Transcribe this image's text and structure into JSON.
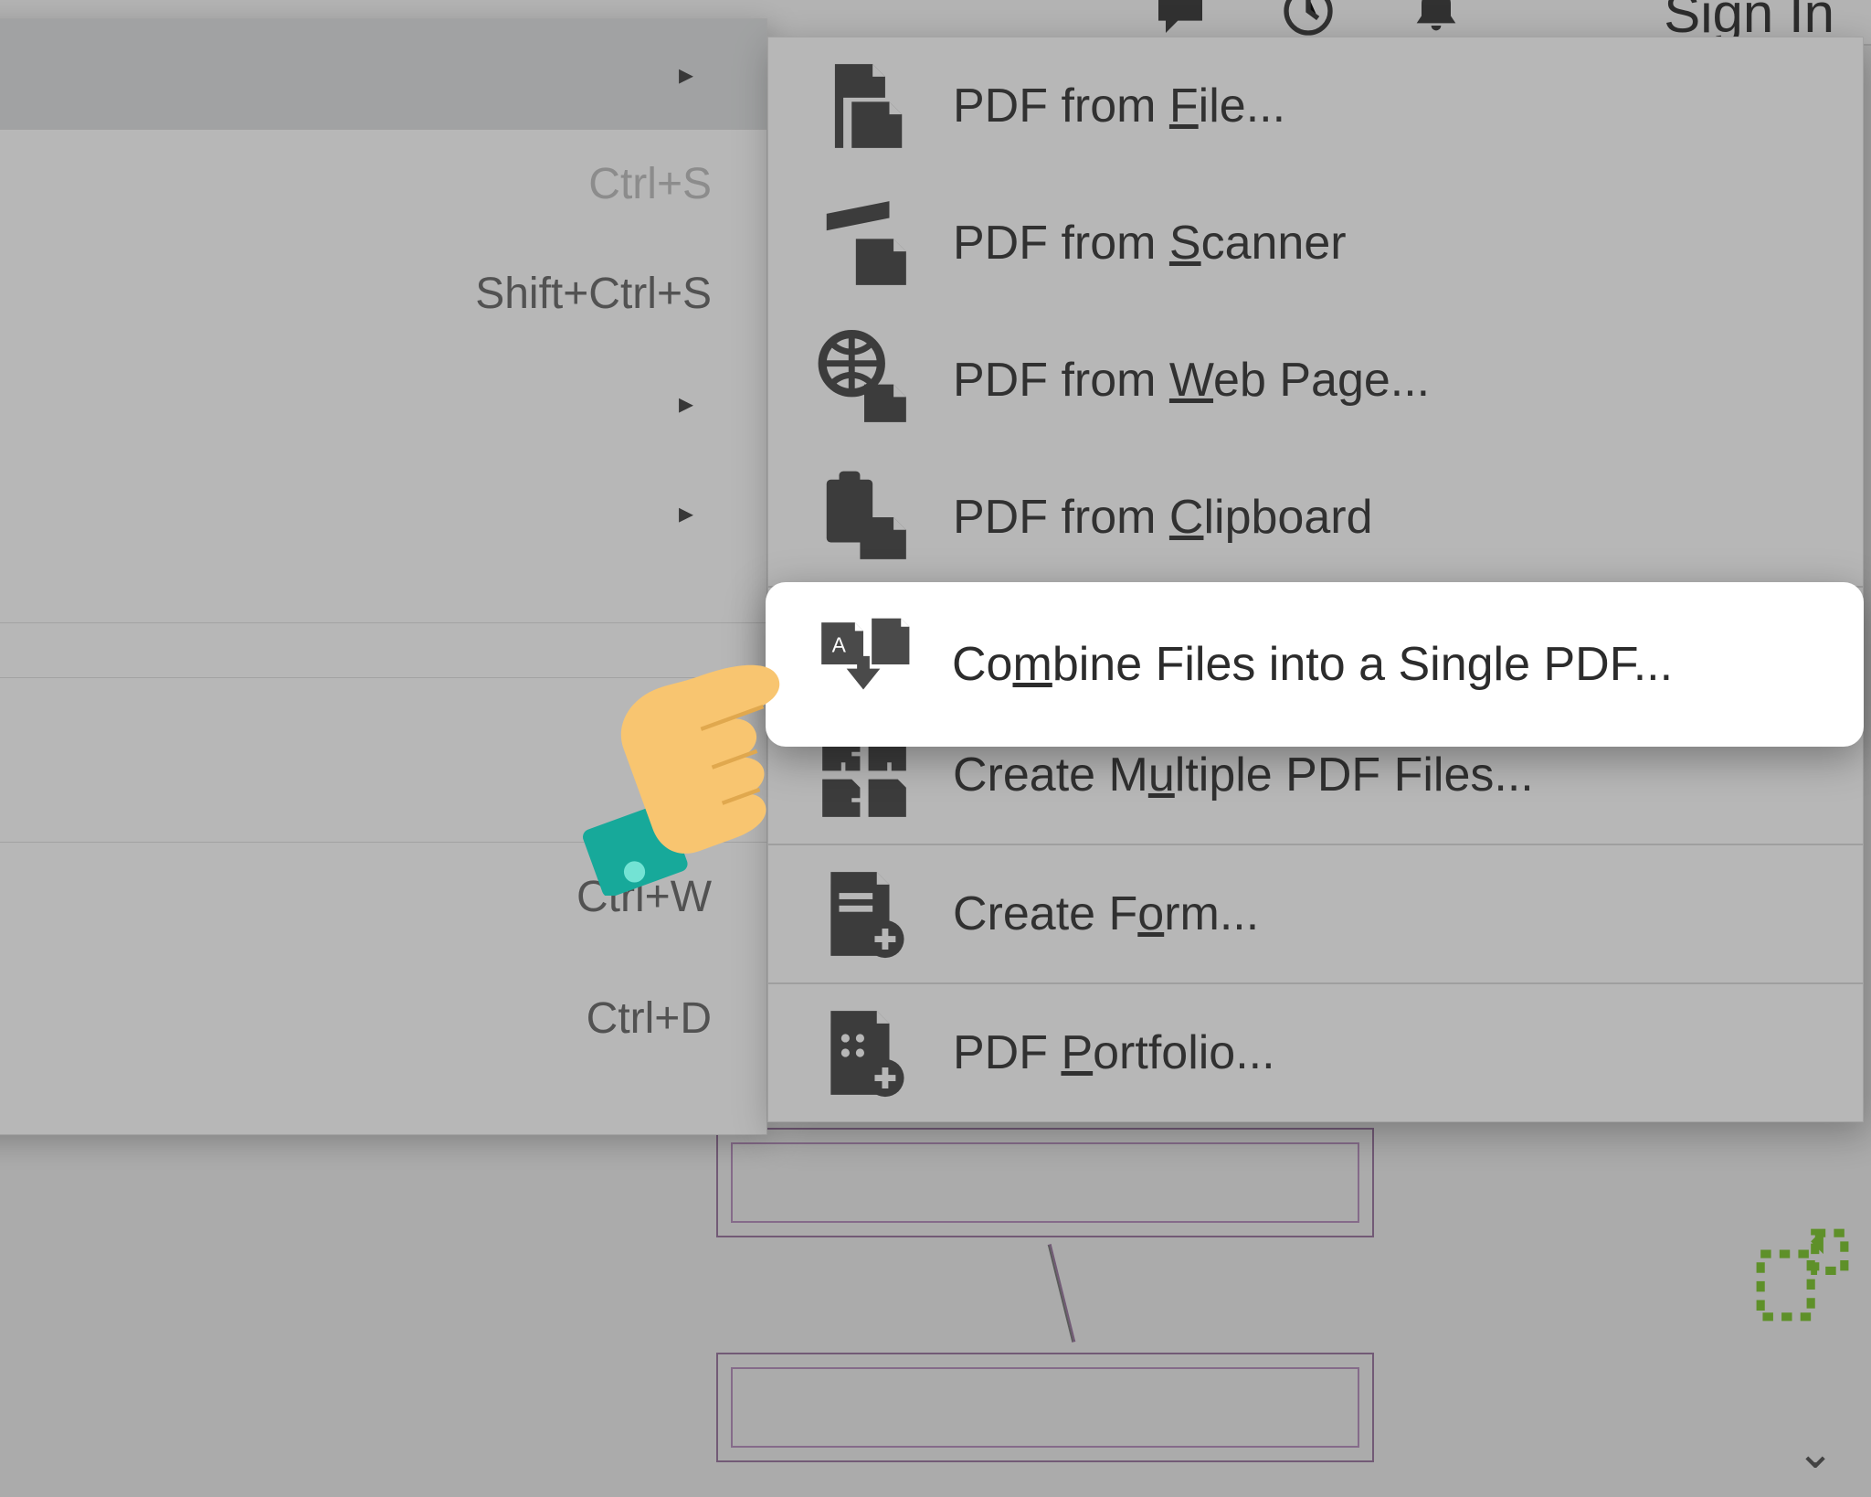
{
  "topbar": {
    "signin_label": "Sign In"
  },
  "leftmenu": {
    "shortcut_save": "Ctrl+S",
    "shortcut_saveas": "Shift+Ctrl+S",
    "shortcut_close": "Ctrl+W",
    "shortcut_properties": "Ctrl+D"
  },
  "submenu": {
    "from_file": "PDF from File...",
    "from_scanner": "PDF from Scanner",
    "from_web": "PDF from Web Page...",
    "from_clipboard": "PDF from Clipboard",
    "combine": "Combine Files into a Single PDF...",
    "multiple": "Create Multiple PDF Files...",
    "form": "Create Form...",
    "portfolio": "PDF Portfolio..."
  },
  "accesskeys": {
    "from_file": "F",
    "from_scanner": "S",
    "from_web": "W",
    "from_clipboard": "C",
    "combine": "m",
    "multiple": "u",
    "form": "o",
    "portfolio": "P"
  }
}
